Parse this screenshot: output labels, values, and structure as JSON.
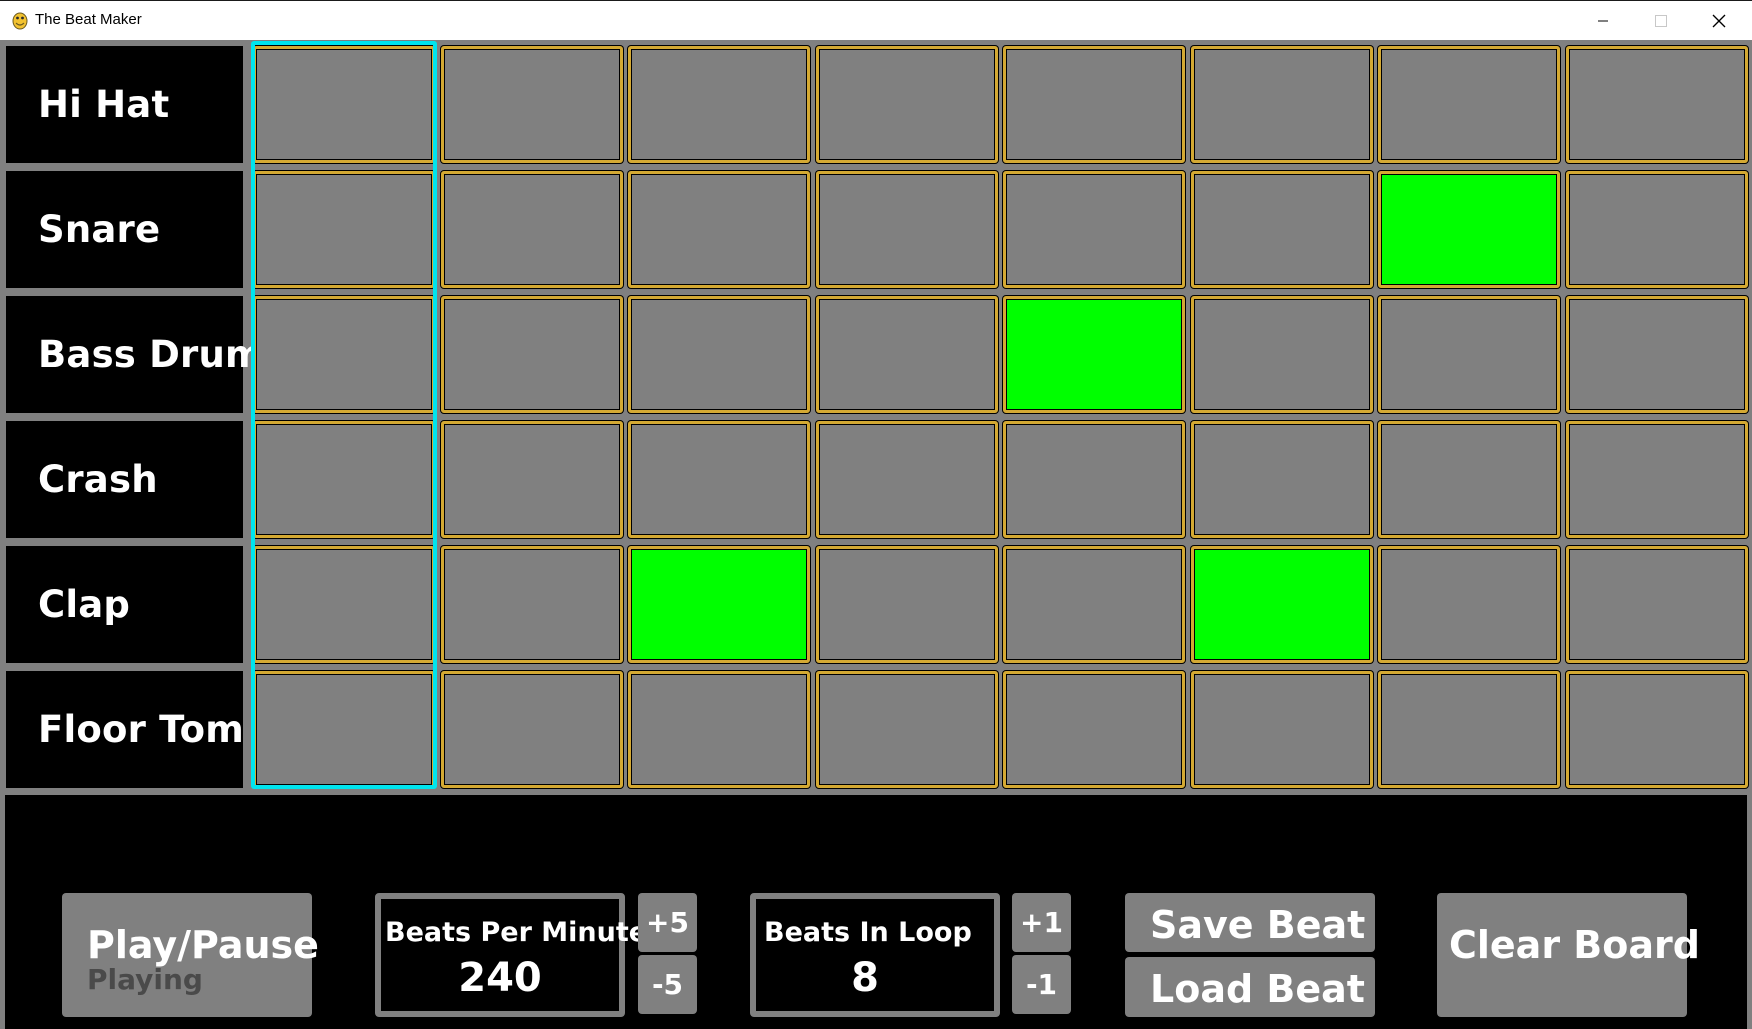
{
  "window": {
    "title": "The Beat Maker",
    "controls": [
      "minimize",
      "maximize",
      "close"
    ]
  },
  "instruments": [
    {
      "label": "Hi Hat"
    },
    {
      "label": "Snare"
    },
    {
      "label": "Bass Drum"
    },
    {
      "label": "Crash"
    },
    {
      "label": "Clap"
    },
    {
      "label": "Floor Tom"
    }
  ],
  "grid": {
    "beats": 8,
    "active_beat_index": 0,
    "active": [
      [
        0,
        0,
        0,
        0,
        0,
        0,
        0,
        0
      ],
      [
        0,
        0,
        0,
        0,
        0,
        0,
        1,
        0
      ],
      [
        0,
        0,
        0,
        0,
        1,
        0,
        0,
        0
      ],
      [
        0,
        0,
        0,
        0,
        0,
        0,
        0,
        0
      ],
      [
        0,
        0,
        1,
        0,
        0,
        1,
        0,
        0
      ],
      [
        0,
        0,
        0,
        0,
        0,
        0,
        0,
        0
      ]
    ]
  },
  "controls": {
    "play_pause": {
      "label": "Play/Pause",
      "status": "Playing"
    },
    "bpm": {
      "label": "Beats Per Minute",
      "value": "240",
      "increase": "+5",
      "decrease": "-5"
    },
    "beats_in_loop": {
      "label": "Beats In Loop",
      "value": "8",
      "increase": "+1",
      "decrease": "-1"
    },
    "save_label": "Save Beat",
    "load_label": "Load Beat",
    "clear_label": "Clear Board"
  },
  "colors": {
    "cell_off": "#808080",
    "cell_on": "#00ff00",
    "cell_border": "#d4a933",
    "playhead": "#00e5ee",
    "button": "#808080",
    "status_text": "#4a4a4a"
  },
  "icons": {
    "app": "pygame-snake-icon",
    "minimize": "minimize-icon",
    "maximize": "maximize-icon",
    "close": "close-icon"
  }
}
